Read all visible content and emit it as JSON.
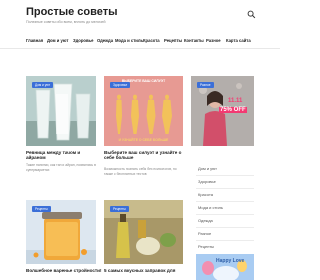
{
  "site": {
    "title": "Простые советы",
    "description": "Полезные советы обо всем, вплоть до мелочей"
  },
  "nav": {
    "items": [
      "Главная",
      "Дом и уют",
      "Здоровье",
      "Одежда",
      "Мода и стиль",
      "Красота",
      "Рецепты",
      "Контакты",
      "Разное",
      "Карта сайта"
    ]
  },
  "cards": [
    {
      "badge": "Дом и уют",
      "title": "Ревница между тачом и айраном",
      "excerpt": "Такие напитки, как тан и айран, появились в супермаркетах"
    },
    {
      "badge": "Здоровье",
      "title": "Выберите ваш силуэт и узнайте о себе больше",
      "excerpt": "Возможность познать себя без психологов, но также с бесплатных тестов"
    },
    {
      "badge": "Разное",
      "title": "",
      "excerpt": ""
    },
    {
      "badge": "Рецепты",
      "title": "Волшебное варенье стройности!",
      "excerpt": ""
    },
    {
      "badge": "Рецепты",
      "title": "5 самых вкусных заправок для",
      "excerpt": ""
    }
  ],
  "card2_image_text": [
    "ВЫБЕРИТЕ ВАШ СИЛУЭТ",
    "И УЗНАЙТЕ О СЕБЕ БОЛЬШЕ"
  ],
  "ad": {
    "date": "11.11",
    "discount": "75% OFF"
  },
  "sidebar": {
    "items": [
      "Дом и уют",
      "Здоровье",
      "Красота",
      "Мода и стиль",
      "Одежда",
      "Разное",
      "Рецепты"
    ]
  },
  "promo": {
    "text": "Happy Love"
  },
  "colors": {
    "accent": "#3b6fd8",
    "ad_pink": "#f33a72"
  }
}
